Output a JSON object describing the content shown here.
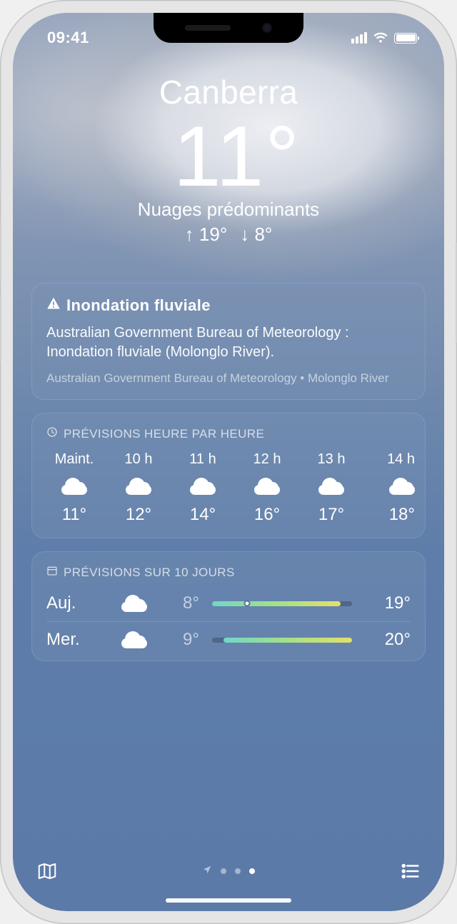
{
  "status": {
    "time": "09:41"
  },
  "hero": {
    "city": "Canberra",
    "temp": "11°",
    "condition": "Nuages prédominants",
    "high": "↑ 19°",
    "low": "↓ 8°"
  },
  "alert": {
    "title": "Inondation fluviale",
    "body": "Australian Government Bureau of Meteorology : Inondation fluviale (Molonglo River).",
    "source": "Australian Government Bureau of Meteorology • Molonglo River"
  },
  "hourly": {
    "header": "PRÉVISIONS HEURE PAR HEURE",
    "items": [
      {
        "label": "Maint.",
        "icon": "cloud",
        "temp": "11°"
      },
      {
        "label": "10 h",
        "icon": "cloud",
        "temp": "12°"
      },
      {
        "label": "11 h",
        "icon": "cloud",
        "temp": "14°"
      },
      {
        "label": "12 h",
        "icon": "cloud",
        "temp": "16°"
      },
      {
        "label": "13 h",
        "icon": "cloud",
        "temp": "17°"
      },
      {
        "label": "14 h",
        "icon": "cloud",
        "temp": "18°"
      }
    ]
  },
  "daily": {
    "header": "PRÉVISIONS SUR 10 JOURS",
    "range_min": 8,
    "range_max": 20,
    "items": [
      {
        "day": "Auj.",
        "icon": "cloud",
        "lo": "8°",
        "hi": "19°",
        "lo_v": 8,
        "hi_v": 19,
        "now_v": 11
      },
      {
        "day": "Mer.",
        "icon": "cloud",
        "lo": "9°",
        "hi": "20°",
        "lo_v": 9,
        "hi_v": 20
      }
    ]
  },
  "pager": {
    "count": 4,
    "active": 3,
    "has_location": true
  }
}
